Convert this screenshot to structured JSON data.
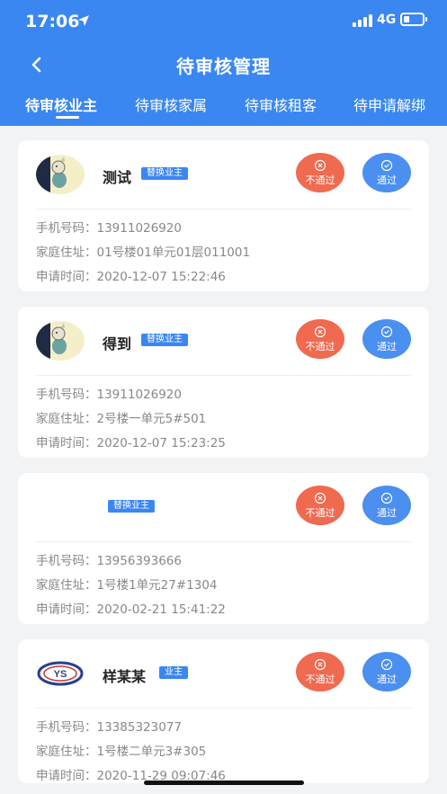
{
  "status_bar": {
    "time": "17:06",
    "network": "4G"
  },
  "header": {
    "title": "待审核管理"
  },
  "tabs": [
    "待审核业主",
    "待审核家属",
    "待审核租客",
    "待申请解绑"
  ],
  "labels": {
    "phone": "手机号码：",
    "address": "家庭住址：",
    "time": "申请时间：",
    "reject": "不通过",
    "approve": "通过"
  },
  "cards": [
    {
      "name": "测试",
      "badge": "替换业主",
      "avatar": "cartoon-fox",
      "phone": "13911026920",
      "address": "01号楼01单元01层011001",
      "time": "2020-12-07 15:22:46"
    },
    {
      "name": "得到",
      "badge": "替换业主",
      "avatar": "cartoon-fox",
      "phone": "13911026920",
      "address": "2号楼一单元5#501",
      "time": "2020-12-07 15:23:25"
    },
    {
      "name": "",
      "badge": "替换业主",
      "avatar": "none",
      "phone": "13956393666",
      "address": "1号楼1单元27#1304",
      "time": "2020-02-21 15:41:22"
    },
    {
      "name": "样某某",
      "badge": "业主",
      "avatar": "ys-logo",
      "logo_text": "YS",
      "phone": "13385323077",
      "address": "1号楼二单元3#305",
      "time": "2020-11-29 09:07:46"
    }
  ],
  "colors": {
    "primary": "#3a87f2",
    "reject": "#f06a50",
    "approve": "#4b8ff0"
  }
}
